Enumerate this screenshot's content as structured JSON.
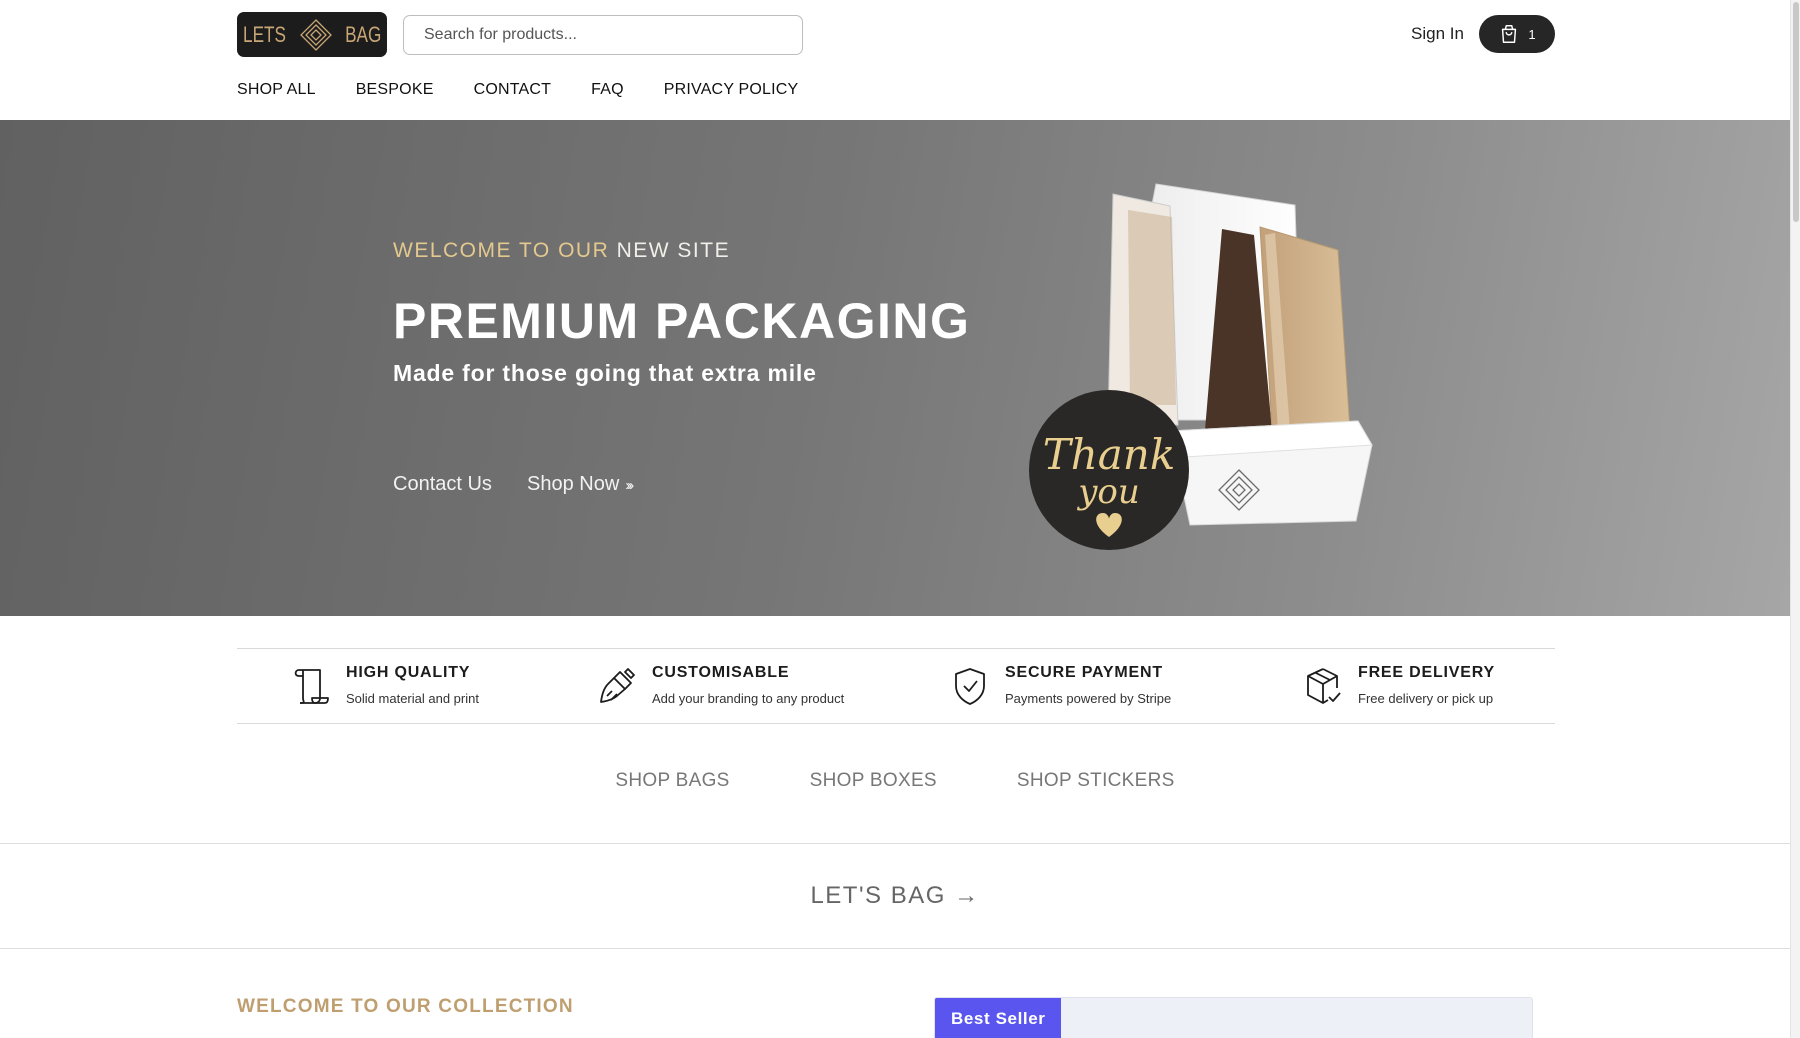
{
  "header": {
    "logo_left": "LETS",
    "logo_right": "BAG",
    "search_placeholder": "Search for products...",
    "sign_in": "Sign In",
    "cart_count": "1"
  },
  "nav": [
    "SHOP ALL",
    "BESPOKE",
    "CONTACT",
    "FAQ",
    "PRIVACY POLICY"
  ],
  "hero": {
    "eyebrow_gold": "WELCOME TO OUR",
    "eyebrow_light": "NEW SITE",
    "headline": "PREMIUM PACKAGING",
    "subheadline": "Made for those going that extra mile",
    "cta_contact": "Contact Us",
    "cta_shop": "Shop Now",
    "sticker_line1": "Thank",
    "sticker_line2": "you"
  },
  "features": [
    {
      "title": "HIGH QUALITY",
      "desc": "Solid material and print",
      "icon": "scroll-icon"
    },
    {
      "title": "CUSTOMISABLE",
      "desc": "Add your branding to any product",
      "icon": "paintbrush-icon"
    },
    {
      "title": "SECURE PAYMENT",
      "desc": "Payments powered by Stripe",
      "icon": "shield-check-icon"
    },
    {
      "title": "FREE DELIVERY",
      "desc": "Free delivery or pick up",
      "icon": "package-check-icon"
    }
  ],
  "categories": [
    "SHOP BAGS",
    "SHOP BOXES",
    "SHOP STICKERS"
  ],
  "band_link": "LET'S BAG →",
  "collection": {
    "heading": "WELCOME TO OUR COLLECTION",
    "badge": "Best Seller"
  },
  "colors": {
    "gold": "#c8a676",
    "badge": "#5b55f0",
    "dark": "#262626"
  }
}
